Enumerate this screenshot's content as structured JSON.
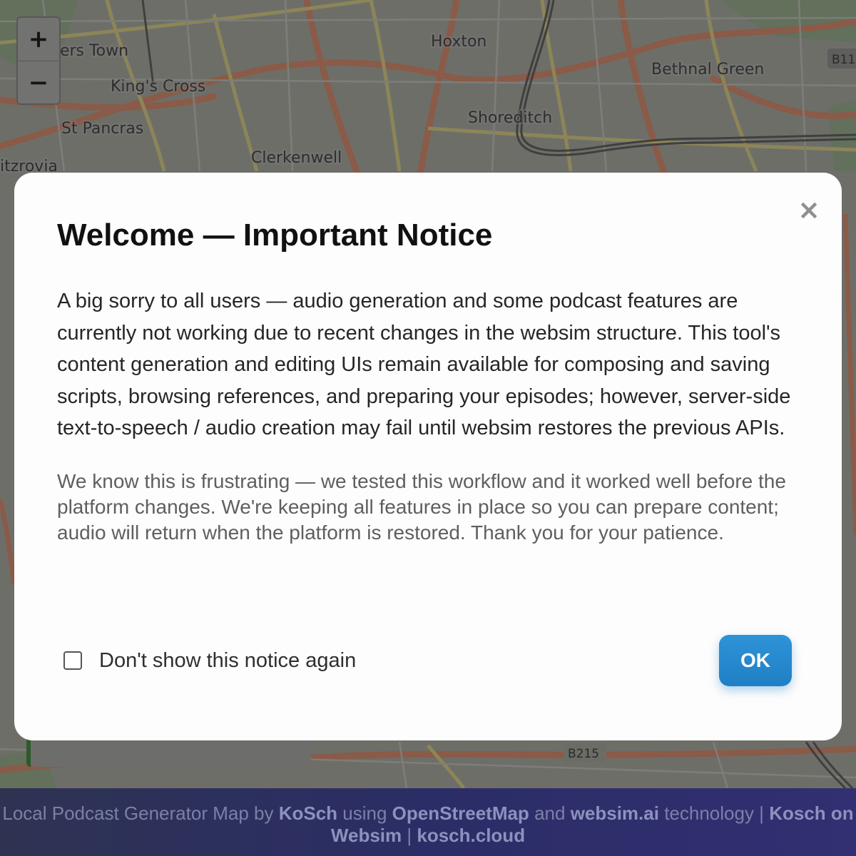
{
  "map": {
    "labels": [
      "hers Town",
      "King's Cross",
      "St Pancras",
      "Clerkenwell",
      "itzrovia",
      "Hoxton",
      "Shoreditch",
      "Bethnal Green"
    ],
    "road_labels": [
      "B11",
      "B215"
    ],
    "zoom_in_icon": "plus-icon",
    "zoom_out_icon": "minus-icon",
    "zoom_in": "+",
    "zoom_out": "−"
  },
  "modal": {
    "title": "Welcome — Important Notice",
    "close": "×",
    "body": "A big sorry to all users — audio generation and some podcast features are currently not working due to recent changes in the websim structure. This tool's content generation and editing UIs remain available for composing and saving scripts, browsing references, and preparing your episodes; however, server-side text-to-speech / audio creation may fail until websim restores the previous APIs.",
    "secondary": "We know this is frustrating — we tested this workflow and it worked well before the platform changes. We're keeping all features in place so you can prepare content; audio will return when the platform is restored. Thank you for your patience.",
    "checkbox_label": "Don't show this notice again",
    "checkbox_checked": false,
    "ok_label": "OK",
    "accent_color": "#2589cf"
  },
  "footer": {
    "prefix": "Local Podcast Generator Map by",
    "author": "KoSch",
    "using": "using",
    "osm": "OpenStreetMap",
    "and": "and",
    "websim": "websim.ai",
    "technology": "technology |",
    "kosch_websim": "Kosch on Websim",
    "sep": "|",
    "site": "kosch.cloud"
  }
}
